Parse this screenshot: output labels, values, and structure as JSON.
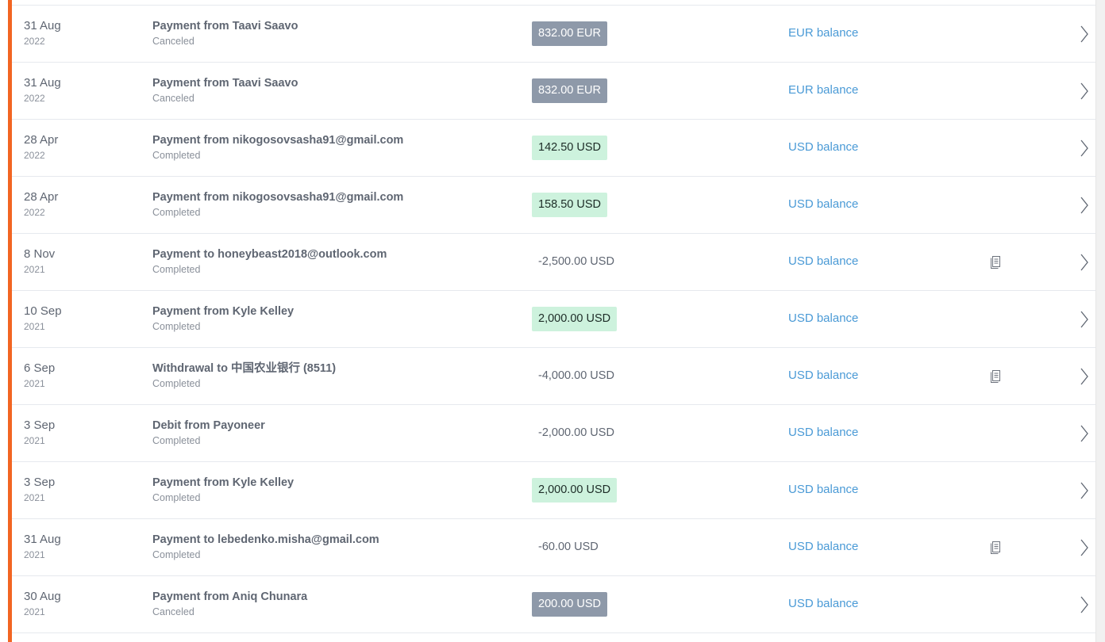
{
  "colors": {
    "accent": "#f26522",
    "canceled_badge": "#8e99a9",
    "credit_badge": "#cdf2dd",
    "balance_link": "#4a9ad6"
  },
  "icons": {
    "document": "receipt-icon",
    "row_action": "chevron-right-icon"
  },
  "transactions": [
    {
      "day": "31 Aug",
      "year": "2022",
      "title": "Payment from Taavi Saavo",
      "status": "Canceled",
      "amount": "832.00 EUR",
      "amount_style": "canceled",
      "balance": "EUR balance",
      "has_document": false
    },
    {
      "day": "31 Aug",
      "year": "2022",
      "title": "Payment from Taavi Saavo",
      "status": "Canceled",
      "amount": "832.00 EUR",
      "amount_style": "canceled",
      "balance": "EUR balance",
      "has_document": false
    },
    {
      "day": "28 Apr",
      "year": "2022",
      "title": "Payment from nikogosovsasha91@gmail.com",
      "status": "Completed",
      "amount": "142.50 USD",
      "amount_style": "credit",
      "balance": "USD balance",
      "has_document": false
    },
    {
      "day": "28 Apr",
      "year": "2022",
      "title": "Payment from nikogosovsasha91@gmail.com",
      "status": "Completed",
      "amount": "158.50 USD",
      "amount_style": "credit",
      "balance": "USD balance",
      "has_document": false
    },
    {
      "day": "8 Nov",
      "year": "2021",
      "title": "Payment to honeybeast2018@outlook.com",
      "status": "Completed",
      "amount": "-2,500.00 USD",
      "amount_style": "plain",
      "balance": "USD balance",
      "has_document": true
    },
    {
      "day": "10 Sep",
      "year": "2021",
      "title": "Payment from Kyle Kelley",
      "status": "Completed",
      "amount": "2,000.00 USD",
      "amount_style": "credit",
      "balance": "USD balance",
      "has_document": false
    },
    {
      "day": "6 Sep",
      "year": "2021",
      "title": "Withdrawal to 中国农业银行 (8511)",
      "status": "Completed",
      "amount": "-4,000.00 USD",
      "amount_style": "plain",
      "balance": "USD balance",
      "has_document": true
    },
    {
      "day": "3 Sep",
      "year": "2021",
      "title": "Debit from Payoneer",
      "status": "Completed",
      "amount": "-2,000.00 USD",
      "amount_style": "plain",
      "balance": "USD balance",
      "has_document": false
    },
    {
      "day": "3 Sep",
      "year": "2021",
      "title": "Payment from Kyle Kelley",
      "status": "Completed",
      "amount": "2,000.00 USD",
      "amount_style": "credit",
      "balance": "USD balance",
      "has_document": false
    },
    {
      "day": "31 Aug",
      "year": "2021",
      "title": "Payment to lebedenko.misha@gmail.com",
      "status": "Completed",
      "amount": "-60.00 USD",
      "amount_style": "plain",
      "balance": "USD balance",
      "has_document": true
    },
    {
      "day": "30 Aug",
      "year": "2021",
      "title": "Payment from Aniq Chunara",
      "status": "Canceled",
      "amount": "200.00 USD",
      "amount_style": "canceled",
      "balance": "USD balance",
      "has_document": false
    }
  ]
}
